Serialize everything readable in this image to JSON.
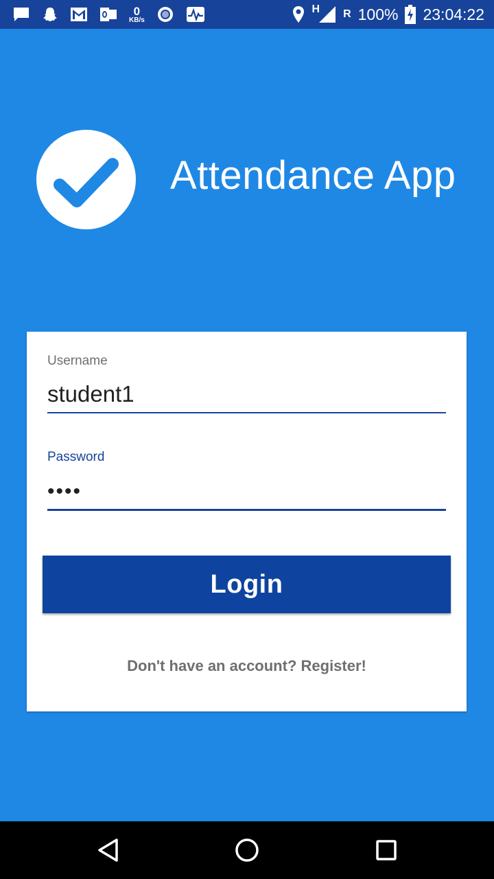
{
  "status_bar": {
    "net_speed_value": "0",
    "net_speed_unit": "KB/s",
    "network_type": "H",
    "roaming": "R",
    "battery": "100%",
    "time": "23:04:22",
    "left_icons": [
      "message-icon",
      "snapchat-icon",
      "gmail-icon",
      "outlook-icon",
      "net-speed-icon",
      "circle-app-icon",
      "pulse-icon"
    ],
    "right_icons": [
      "location-icon",
      "signal-icon",
      "battery-charging-icon"
    ]
  },
  "header": {
    "app_title": "Attendance App",
    "logo_icon": "check-circle-icon"
  },
  "login_form": {
    "username_label": "Username",
    "username_value": "student1",
    "password_label": "Password",
    "password_value": "••••",
    "login_label": "Login",
    "register_text": "Don't have an account? Register!"
  },
  "nav_bar": {
    "icons": [
      "back-icon",
      "home-icon",
      "recents-icon"
    ]
  },
  "colors": {
    "background": "#1f88e5",
    "status_bar": "#17439a",
    "primary_dark": "#0e44a0",
    "card": "#ffffff"
  }
}
